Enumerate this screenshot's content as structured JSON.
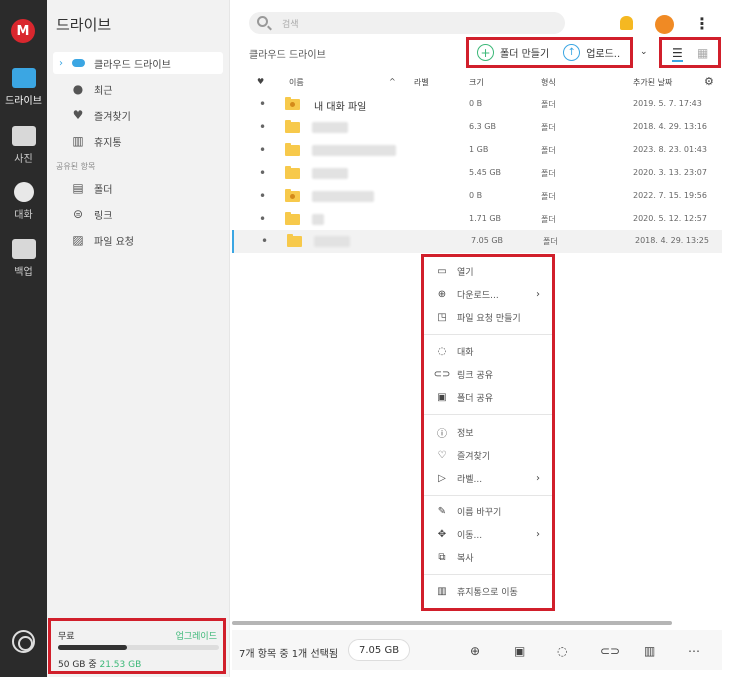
{
  "rail": {
    "logo": "M",
    "items": [
      {
        "label": "드라이브",
        "icon": "folder-icon"
      },
      {
        "label": "사진",
        "icon": "photo-icon"
      },
      {
        "label": "대화",
        "icon": "chat-icon"
      },
      {
        "label": "백업",
        "icon": "backup-icon"
      }
    ]
  },
  "sidebar": {
    "title": "드라이브",
    "nav": [
      {
        "label": "클라우드 드라이브",
        "icon": "cloud-icon"
      },
      {
        "label": "최근",
        "icon": "clock-icon"
      },
      {
        "label": "즐겨찾기",
        "icon": "heart-icon"
      },
      {
        "label": "휴지통",
        "icon": "trash-icon"
      }
    ],
    "shared_section": "공유된 항목",
    "shared": [
      {
        "label": "폴더",
        "icon": "shared-folder-icon"
      },
      {
        "label": "링크",
        "icon": "link-icon"
      },
      {
        "label": "파일 요청",
        "icon": "file-request-icon"
      }
    ],
    "storage": {
      "plan": "무료",
      "upgrade": "업그레이드",
      "used_fraction": 0.43,
      "total_text": "50 GB 중",
      "used_text": "21.53 GB"
    }
  },
  "topbar": {
    "search_placeholder": "검색"
  },
  "breadcrumb": "클라우드 드라이브",
  "toolbar": {
    "new_folder": "폴더 만들기",
    "upload": "업로드..",
    "list_view_icon": "list-icon",
    "grid_view_icon": "grid-icon"
  },
  "table": {
    "headers": {
      "name": "이름",
      "label": "라벨",
      "size": "크기",
      "type": "형식",
      "date": "추가된 날짜"
    },
    "rows": [
      {
        "name": "내 대화 파일",
        "size": "0 B",
        "type": "폴더",
        "date": "2019. 5. 7. 17:43",
        "shared": true
      },
      {
        "name": "",
        "size": "6.3 GB",
        "type": "폴더",
        "date": "2018. 4. 29. 13:16",
        "shared": false
      },
      {
        "name": "",
        "size": "1 GB",
        "type": "폴더",
        "date": "2023. 8. 23. 01:43",
        "shared": false
      },
      {
        "name": "",
        "size": "5.45 GB",
        "type": "폴더",
        "date": "2020. 3. 13. 23:07",
        "shared": false
      },
      {
        "name": "",
        "size": "0 B",
        "type": "폴더",
        "date": "2022. 7. 15. 19:56",
        "shared": true
      },
      {
        "name": "",
        "size": "1.71 GB",
        "type": "폴더",
        "date": "2020. 5. 12. 12:57",
        "shared": false
      },
      {
        "name": "",
        "size": "7.05 GB",
        "type": "폴더",
        "date": "2018. 4. 29. 13:25",
        "shared": false
      }
    ]
  },
  "context_menu": {
    "items": [
      {
        "label": "열기",
        "icon": "folder-open-icon"
      },
      {
        "label": "다운로드...",
        "icon": "download-icon",
        "submenu": true
      },
      {
        "label": "파일 요청 만들기",
        "icon": "file-request-icon"
      },
      {
        "label": "대화",
        "icon": "chat-icon"
      },
      {
        "label": "링크 공유",
        "icon": "link-icon"
      },
      {
        "label": "폴더 공유",
        "icon": "share-folder-icon"
      },
      {
        "label": "정보",
        "icon": "info-icon"
      },
      {
        "label": "즐겨찾기",
        "icon": "heart-icon"
      },
      {
        "label": "라벨...",
        "icon": "label-icon",
        "submenu": true
      },
      {
        "label": "이름 바꾸기",
        "icon": "pencil-icon"
      },
      {
        "label": "이동...",
        "icon": "move-icon",
        "submenu": true
      },
      {
        "label": "복사",
        "icon": "copy-icon"
      },
      {
        "label": "휴지통으로 이동",
        "icon": "trash-icon"
      }
    ]
  },
  "bottom": {
    "selection": "7개 항목 중 1개 선택됨",
    "selected_size": "7.05 GB"
  },
  "colors": {
    "rail_bg": "#2b2b2b",
    "brand_red": "#d9272e",
    "highlight_red": "#d11f2b",
    "accent_green": "#3cb878",
    "accent_blue": "#3ba6e3",
    "folder_yellow": "#f7c94b"
  }
}
